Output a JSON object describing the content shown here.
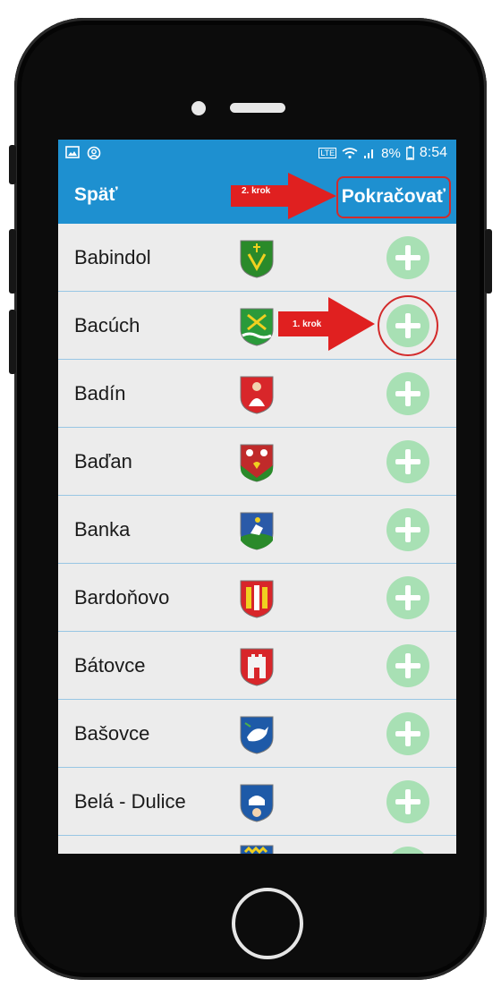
{
  "status_bar": {
    "left_icons": [
      "image-icon",
      "account-circle-icon"
    ],
    "network": "LTE",
    "battery": "8%",
    "time": "8:54"
  },
  "toolbar": {
    "back_label": "Späť",
    "continue_label": "Pokračovať"
  },
  "annotations": {
    "step1": "1. krok",
    "step2": "2. krok",
    "color": "#e02020"
  },
  "colors": {
    "toolbar": "#1e90d0",
    "add_button": "#a8e0b4",
    "list_bg": "#ececec"
  },
  "list": [
    {
      "name": "Babindol"
    },
    {
      "name": "Bacúch"
    },
    {
      "name": "Badín"
    },
    {
      "name": "Baďan"
    },
    {
      "name": "Banka"
    },
    {
      "name": "Bardoňovo"
    },
    {
      "name": "Bátovce"
    },
    {
      "name": "Bašovce"
    },
    {
      "name": "Belá - Dulice"
    }
  ]
}
